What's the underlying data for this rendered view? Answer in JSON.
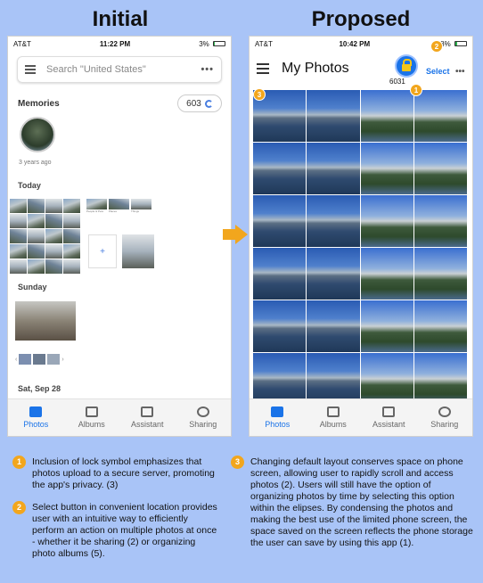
{
  "headings": {
    "initial": "Initial",
    "proposed": "Proposed"
  },
  "left_phone": {
    "status": {
      "carrier": "AT&T",
      "time": "11:22 PM",
      "battery": "3%",
      "battery_level": 0.03
    },
    "search_placeholder": "Search \"United States\"",
    "more_label": "•••",
    "memories_label": "Memories",
    "memories_count": "603",
    "memory_age": "3 years ago",
    "sections": [
      "Today",
      "Sunday",
      "Sat, Sep 28"
    ],
    "mini_labels": [
      "People & Pets",
      "Places",
      "Things"
    ],
    "new_album_label": "+",
    "tabs": [
      "Photos",
      "Albums",
      "Assistant",
      "Sharing"
    ]
  },
  "right_phone": {
    "status": {
      "carrier": "AT&T",
      "time": "10:42 PM",
      "battery": "18%",
      "battery_level": 0.18
    },
    "title": "My Photos",
    "lock_count": "6031",
    "select_label": "Select",
    "more_label": "•••",
    "tabs": [
      "Photos",
      "Albums",
      "Assistant",
      "Sharing"
    ],
    "badges": [
      "1",
      "2",
      "3"
    ]
  },
  "notes": [
    {
      "num": "1",
      "text": "Inclusion of lock symbol emphasizes that photos upload to a secure server, promoting the app's privacy. (3)"
    },
    {
      "num": "2",
      "text": "Select button in convenient location provides user with an intuitive way to efficiently perform an action on multiple photos at once - whether it be sharing (2) or organizing photo albums (5)."
    },
    {
      "num": "3",
      "text": "Changing default layout conserves space on phone screen, allowing user to rapidly scroll and access photos (2). Users will still have the option of organizing photos by time by selecting this option within the elipses. By condensing the photos and making the best use of the limited phone screen, the space saved on the screen reflects the phone storage the user can save by using this app (1)."
    }
  ],
  "colors": {
    "accent": "#1a73e8",
    "badge": "#f2a61d",
    "background": "#a9c4f7"
  }
}
